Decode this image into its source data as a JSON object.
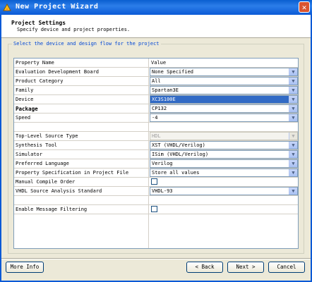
{
  "window": {
    "title": "New Project Wizard",
    "close_glyph": "✕"
  },
  "header": {
    "title": "Project Settings",
    "subtitle": "Specify device and project properties."
  },
  "group_label": "Select the device and design flow for the project",
  "columns": {
    "name": "Property Name",
    "value": "Value"
  },
  "rows": [
    {
      "name": "Evaluation Development Board",
      "value": "None Specified"
    },
    {
      "name": "Product Category",
      "value": "All"
    },
    {
      "name": "Family",
      "value": "Spartan3E"
    },
    {
      "name": "Device",
      "value": "XC3S100E"
    },
    {
      "name": "Package",
      "value": "CP132"
    },
    {
      "name": "Speed",
      "value": "-4"
    },
    {
      "name": "Top-Level Source Type",
      "value": "HDL"
    },
    {
      "name": "Synthesis Tool",
      "value": "XST (VHDL/Verilog)"
    },
    {
      "name": "Simulator",
      "value": "ISim (VHDL/Verilog)"
    },
    {
      "name": "Preferred Language",
      "value": "Verilog"
    },
    {
      "name": "Property Specification in Project File",
      "value": "Store all values"
    },
    {
      "name": "Manual Compile Order",
      "value": ""
    },
    {
      "name": "VHDL Source Analysis Standard",
      "value": "VHDL-93"
    },
    {
      "name": "Enable Message Filtering",
      "value": ""
    }
  ],
  "buttons": {
    "more_info": "More Info",
    "back": "< Back",
    "next": "Next >",
    "cancel": "Cancel"
  }
}
